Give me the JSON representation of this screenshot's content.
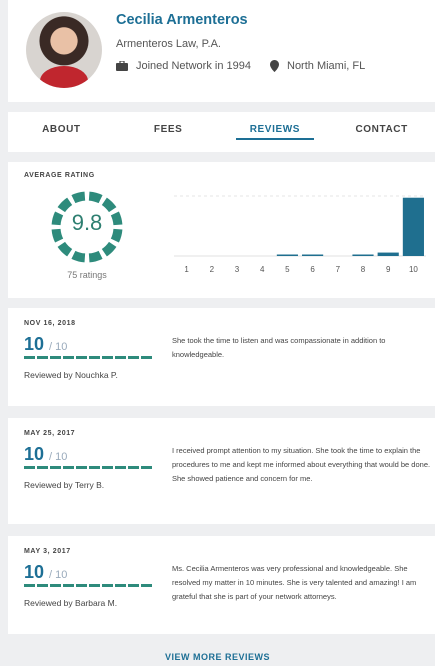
{
  "profile": {
    "name": "Cecilia Armenteros",
    "firm": "Armenteros Law, P.A.",
    "joined": "Joined Network in 1994",
    "location": "North Miami, FL"
  },
  "tabs": [
    {
      "label": "ABOUT",
      "active": false
    },
    {
      "label": "FEES",
      "active": false
    },
    {
      "label": "REVIEWS",
      "active": true
    },
    {
      "label": "CONTACT",
      "active": false
    }
  ],
  "rating": {
    "heading": "AVERAGE RATING",
    "score": "9.8",
    "count_text": "75 ratings",
    "accent": "#2e8b7c"
  },
  "chart_data": {
    "type": "bar",
    "categories": [
      "1",
      "2",
      "3",
      "4",
      "5",
      "6",
      "7",
      "8",
      "9",
      "10"
    ],
    "values": [
      0,
      0,
      0,
      0,
      1,
      1,
      0,
      1,
      4,
      68
    ],
    "ylim": [
      0,
      70
    ],
    "grid": true,
    "color": "#1f6f8f"
  },
  "reviews": [
    {
      "date": "NOV 16, 2018",
      "score": "10",
      "of": "/ 10",
      "reviewer": "Reviewed by Nouchka P.",
      "text": "She took the time to listen and was compassionate in addition to knowledgeable."
    },
    {
      "date": "MAY 25, 2017",
      "score": "10",
      "of": "/ 10",
      "reviewer": "Reviewed by Terry B.",
      "text": "I received prompt attention to my situation. She took the time to explain the procedures to me and kept me informed about everything that would be done. She showed patience and concern for me."
    },
    {
      "date": "MAY 3, 2017",
      "score": "10",
      "of": "/ 10",
      "reviewer": "Reviewed by Barbara M.",
      "text": "Ms. Cecilia Armenteros was very professional and knowledgeable. She resolved my matter in 10 minutes. She is very talented and amazing! I am grateful that she is part of your network attorneys."
    }
  ],
  "view_more": "VIEW MORE REVIEWS"
}
